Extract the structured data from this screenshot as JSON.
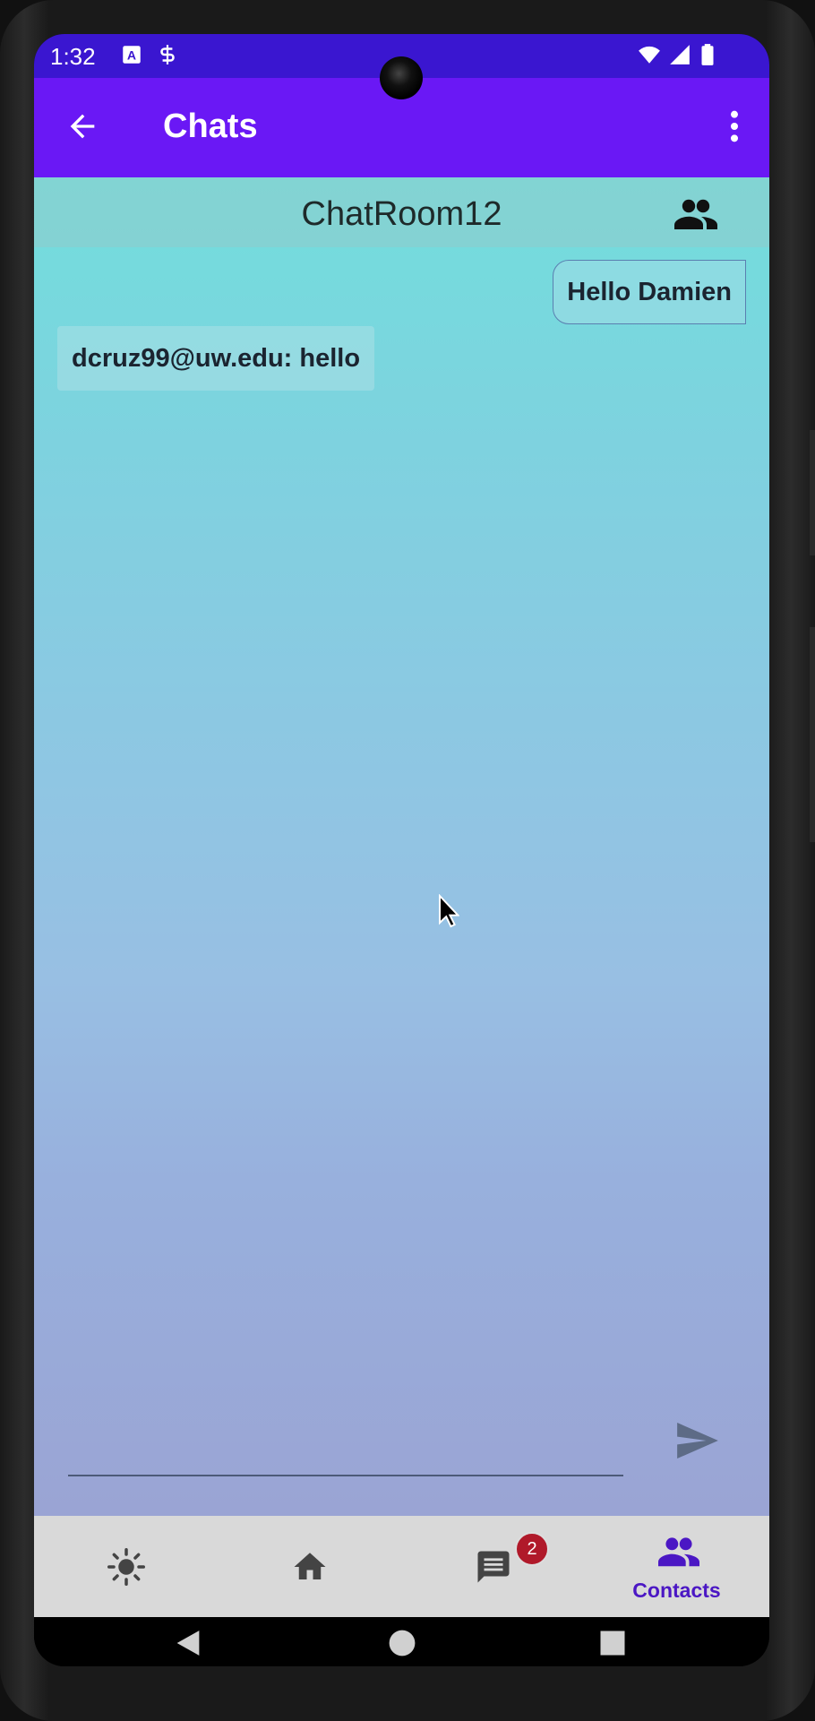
{
  "status_bar": {
    "time": "1:32"
  },
  "app_bar": {
    "title": "Chats"
  },
  "chat_room": {
    "name": "ChatRoom12",
    "messages": [
      {
        "direction": "sent",
        "text": "Hello Damien"
      },
      {
        "direction": "received",
        "text": "dcruz99@uw.edu: hello"
      }
    ]
  },
  "composer": {
    "value": "",
    "placeholder": ""
  },
  "bottom_nav": {
    "items": [
      {
        "icon": "weather-sun-icon",
        "label": ""
      },
      {
        "icon": "home-icon",
        "label": ""
      },
      {
        "icon": "chat-icon",
        "label": "",
        "badge": "2"
      },
      {
        "icon": "contacts-icon",
        "label": "Contacts",
        "selected": true
      }
    ]
  },
  "colors": {
    "status_bar": "#3a16d0",
    "app_bar": "#6a18f5",
    "accent_selected": "#4b17c4",
    "badge": "#b0192a",
    "nav_background": "#d9d9d9"
  }
}
